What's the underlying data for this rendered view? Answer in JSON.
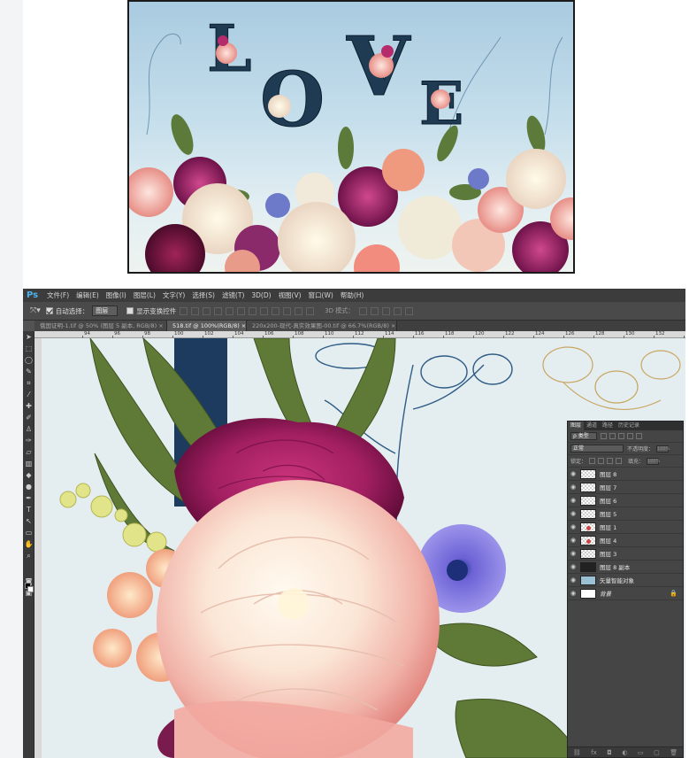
{
  "preview": {
    "title_text": "LOVE"
  },
  "photoshop": {
    "logo": "Ps",
    "menu": [
      "文件(F)",
      "编辑(E)",
      "图像(I)",
      "图层(L)",
      "文字(Y)",
      "选择(S)",
      "滤镜(T)",
      "3D(D)",
      "视图(V)",
      "窗口(W)",
      "帮助(H)"
    ],
    "options": {
      "auto_select_label": "自动选择：",
      "auto_select_checked": true,
      "auto_select_value": "图层",
      "show_transform_label": "显示变换控件",
      "show_transform_checked": false,
      "mode_3d_label": "3D 模式："
    },
    "doc_tabs": [
      {
        "label": "俄国证明-1.tif @ 50% (图层 5 副本, RGB/8) ×",
        "active": false
      },
      {
        "label": "518.tif @ 100%(RGB/8) ×",
        "active": true
      },
      {
        "label": "220x200-现代-真实效果图-00.tif @ 66.7%(RGB/8) ×",
        "active": false
      }
    ],
    "ruler_numbers": [
      "94",
      "96",
      "98",
      "100",
      "102",
      "104",
      "106",
      "108",
      "110",
      "112",
      "114",
      "116",
      "118",
      "120",
      "122",
      "124",
      "126",
      "128",
      "130",
      "132",
      "134"
    ],
    "layers_panel": {
      "tabs": [
        "图层",
        "通道",
        "路径",
        "历史记录"
      ],
      "filter_label": "ρ 类型",
      "blend_mode": "正常",
      "opacity_label": "不透明度：",
      "opacity_value": "100%",
      "lock_label": "锁定：",
      "fill_label": "填充：",
      "fill_value": "100%",
      "layers": [
        {
          "name": "图层 8",
          "thumb": "checker",
          "selected": false
        },
        {
          "name": "图层 7",
          "thumb": "checker",
          "selected": false
        },
        {
          "name": "图层 6",
          "thumb": "checker",
          "selected": false
        },
        {
          "name": "图层 5",
          "thumb": "checker",
          "selected": false
        },
        {
          "name": "图层 1",
          "thumb": "flower",
          "selected": false
        },
        {
          "name": "图层 4",
          "thumb": "flower",
          "selected": false
        },
        {
          "name": "图层 3",
          "thumb": "checker",
          "selected": false
        },
        {
          "name": "图层 8 副本",
          "thumb": "dark",
          "selected": false
        },
        {
          "name": "矢量智能对象",
          "thumb": "blue",
          "selected": false
        },
        {
          "name": "背景",
          "thumb": "white",
          "selected": false
        }
      ]
    }
  }
}
